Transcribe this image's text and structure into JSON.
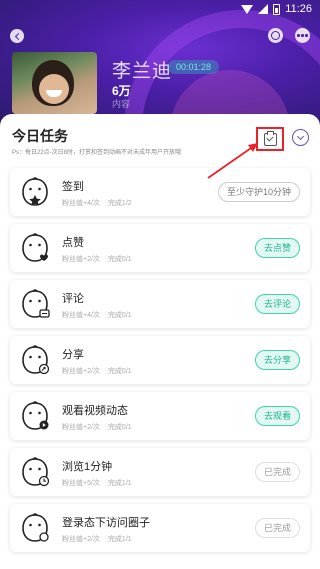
{
  "status_bar": {
    "time": "11:26"
  },
  "host": {
    "name": "李兰迪",
    "live_time": "00:01:28",
    "fans_count": "6万",
    "fans_label": "内容"
  },
  "daily_tasks": {
    "title": "今日任务",
    "note": "Ps：每日22点-次日8时，打赏和签到动画不对未成年用户开放哦",
    "tasks": [
      {
        "name": "签到",
        "points": "粉丝值+4/次",
        "progress": "完成1/2",
        "button": "至少守护10分钟",
        "state": "disabled",
        "icon": "star-face-icon"
      },
      {
        "name": "点赞",
        "points": "粉丝值+2/次",
        "progress": "完成0/1",
        "button": "去点赞",
        "state": "active",
        "icon": "heart-face-icon"
      },
      {
        "name": "评论",
        "points": "粉丝值+4/次",
        "progress": "完成0/1",
        "button": "去评论",
        "state": "active",
        "icon": "comment-face-icon"
      },
      {
        "name": "分享",
        "points": "粉丝值+2/次",
        "progress": "完成0/1",
        "button": "去分享",
        "state": "active",
        "icon": "share-face-icon"
      },
      {
        "name": "观看视频动态",
        "points": "粉丝值+2/次",
        "progress": "完成0/1",
        "button": "去观看",
        "state": "active",
        "icon": "video-face-icon"
      },
      {
        "name": "浏览1分钟",
        "points": "粉丝值+5/次",
        "progress": "完成1/1",
        "button": "已完成",
        "state": "done",
        "icon": "clock-face-icon"
      },
      {
        "name": "登录态下访问圈子",
        "points": "粉丝值+2/次",
        "progress": "完成1/1",
        "button": "已完成",
        "state": "done",
        "icon": "visit-face-icon"
      }
    ]
  },
  "colors": {
    "accent": "#3ed3b4",
    "highlight": "#e8232a",
    "purple": "#4c1fa8"
  }
}
